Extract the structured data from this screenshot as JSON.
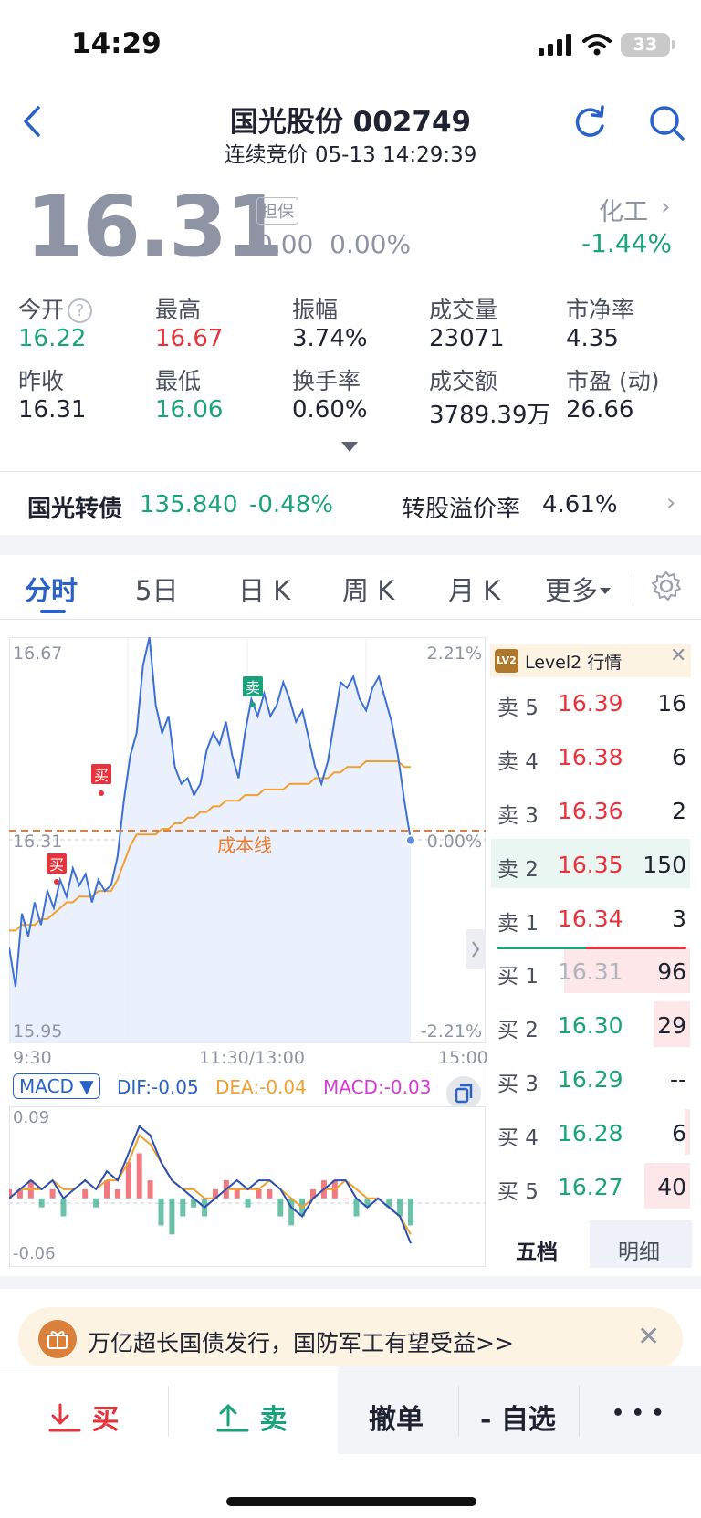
{
  "status_bar": {
    "time": "14:29",
    "battery": "33"
  },
  "header": {
    "title": "国光股份 002749",
    "subtitle": "连续竞价 05-13 14:29:39"
  },
  "quote": {
    "price": "16.31",
    "guarantee_tag": "担保",
    "change": "0.00",
    "change_pct": "0.00%",
    "sector_name": "化工",
    "sector_change": "-1.44%"
  },
  "stats": [
    {
      "label": "今开",
      "value": "16.22",
      "color": "green"
    },
    {
      "label": "最高",
      "value": "16.67",
      "color": "red"
    },
    {
      "label": "振幅",
      "value": "3.74%",
      "color": "neutral"
    },
    {
      "label": "成交量",
      "value": "23071",
      "color": "neutral"
    },
    {
      "label": "市净率",
      "value": "4.35",
      "color": "neutral"
    },
    {
      "label": "昨收",
      "value": "16.31",
      "color": "neutral"
    },
    {
      "label": "最低",
      "value": "16.06",
      "color": "green"
    },
    {
      "label": "换手率",
      "value": "0.60%",
      "color": "neutral"
    },
    {
      "label": "成交额",
      "value": "3789.39万",
      "color": "neutral"
    },
    {
      "label": "市盈 (动)",
      "value": "26.66",
      "color": "neutral"
    }
  ],
  "bond": {
    "name": "国光转债",
    "price": "135.840",
    "change": "-0.48%",
    "premium_label": "转股溢价率",
    "premium_value": "4.61%"
  },
  "tabs": [
    "分时",
    "5日",
    "日 K",
    "周 K",
    "月 K",
    "更多"
  ],
  "active_tab": "分时",
  "chart": {
    "y_top": "16.67",
    "y_mid": "16.31",
    "y_bottom": "15.95",
    "pct_top": "2.21%",
    "pct_mid": "0.00%",
    "pct_bottom": "-2.21%",
    "x_labels": [
      "9:30",
      "11:30/13:00",
      "15:00"
    ],
    "cost_line_label": "成本线",
    "buy_marker": "买",
    "sell_marker": "卖"
  },
  "macd": {
    "selector": "MACD ▼",
    "dif": "DIF:-0.05",
    "dea": "DEA:-0.04",
    "macd": "MACD:-0.03",
    "y_top": "0.09",
    "y_bottom": "-0.06"
  },
  "chart_data": {
    "type": "line",
    "title": "",
    "x_labels": [
      "9:30",
      "11:30/13:00",
      "15:00"
    ],
    "ylim": [
      15.95,
      16.67
    ],
    "series": [
      {
        "name": "price",
        "values": [
          16.12,
          16.05,
          16.18,
          16.14,
          16.2,
          16.16,
          16.22,
          16.19,
          16.24,
          16.21,
          16.26,
          16.23,
          16.25,
          16.2,
          16.24,
          16.22,
          16.23,
          16.28,
          16.38,
          16.46,
          16.5,
          16.62,
          16.67,
          16.55,
          16.5,
          16.53,
          16.44,
          16.41,
          16.42,
          16.39,
          16.41,
          16.47,
          16.5,
          16.48,
          16.52,
          16.46,
          16.42,
          16.5,
          16.56,
          16.53,
          16.57,
          16.53,
          16.55,
          16.59,
          16.56,
          16.52,
          16.54,
          16.49,
          16.44,
          16.41,
          16.45,
          16.52,
          16.59,
          16.58,
          16.6,
          16.56,
          16.54,
          16.58,
          16.6,
          16.56,
          16.52,
          16.46,
          16.38,
          16.31
        ]
      },
      {
        "name": "avg",
        "values": [
          16.15,
          16.15,
          16.16,
          16.16,
          16.16,
          16.17,
          16.17,
          16.18,
          16.19,
          16.2,
          16.2,
          16.21,
          16.21,
          16.21,
          16.22,
          16.22,
          16.22,
          16.24,
          16.27,
          16.3,
          16.32,
          16.32,
          16.32,
          16.32,
          16.33,
          16.33,
          16.34,
          16.34,
          16.35,
          16.35,
          16.36,
          16.36,
          16.37,
          16.37,
          16.38,
          16.38,
          16.38,
          16.39,
          16.39,
          16.39,
          16.4,
          16.4,
          16.4,
          16.4,
          16.41,
          16.41,
          16.41,
          16.41,
          16.42,
          16.42,
          16.42,
          16.43,
          16.43,
          16.44,
          16.44,
          16.44,
          16.45,
          16.45,
          16.45,
          16.45,
          16.45,
          16.45,
          16.44,
          16.44
        ]
      }
    ]
  },
  "macd_data": {
    "dif": [
      0.0,
      0.01,
      0.02,
      0.01,
      0.02,
      0.0,
      0.01,
      0.02,
      0.01,
      0.03,
      0.02,
      0.05,
      0.08,
      0.07,
      0.04,
      0.02,
      0.01,
      0.0,
      -0.01,
      0.0,
      0.01,
      0.02,
      0.01,
      0.02,
      0.02,
      0.01,
      -0.01,
      -0.02,
      0.0,
      0.01,
      0.02,
      0.02,
      0.0,
      -0.01,
      0.0,
      -0.01,
      -0.02,
      -0.05
    ],
    "dea": [
      0.0,
      0.01,
      0.01,
      0.01,
      0.02,
      0.01,
      0.01,
      0.02,
      0.01,
      0.02,
      0.02,
      0.04,
      0.07,
      0.06,
      0.04,
      0.02,
      0.01,
      0.01,
      0.0,
      0.0,
      0.01,
      0.01,
      0.01,
      0.01,
      0.02,
      0.01,
      0.0,
      -0.01,
      0.0,
      0.01,
      0.01,
      0.02,
      0.01,
      0.0,
      0.0,
      -0.01,
      -0.02,
      -0.04
    ],
    "hist": [
      0.01,
      0.01,
      0.02,
      -0.01,
      0.01,
      -0.02,
      0.0,
      0.01,
      -0.01,
      0.02,
      0.01,
      0.04,
      0.05,
      0.02,
      -0.03,
      -0.04,
      -0.02,
      -0.01,
      -0.02,
      0.01,
      0.02,
      0.01,
      -0.01,
      0.01,
      0.01,
      -0.02,
      -0.03,
      -0.02,
      0.01,
      0.02,
      0.02,
      0.0,
      -0.02,
      -0.01,
      0.0,
      -0.01,
      -0.02,
      -0.03
    ]
  },
  "order_book": {
    "header": "Level2 行情",
    "asks": [
      {
        "label": "卖 5",
        "price": "16.39",
        "qty": "16"
      },
      {
        "label": "卖 4",
        "price": "16.38",
        "qty": "6"
      },
      {
        "label": "卖 3",
        "price": "16.36",
        "qty": "2"
      },
      {
        "label": "卖 2",
        "price": "16.35",
        "qty": "150"
      },
      {
        "label": "卖 1",
        "price": "16.34",
        "qty": "3"
      }
    ],
    "bids": [
      {
        "label": "买 1",
        "price": "16.31",
        "qty": "96"
      },
      {
        "label": "买 2",
        "price": "16.30",
        "qty": "29"
      },
      {
        "label": "买 3",
        "price": "16.29",
        "qty": "--"
      },
      {
        "label": "买 4",
        "price": "16.28",
        "qty": "6"
      },
      {
        "label": "买 5",
        "price": "16.27",
        "qty": "40"
      }
    ],
    "tabs": [
      "五档",
      "明细"
    ]
  },
  "banner": {
    "text": "万亿超长国债发行，国防军工有望受益>>"
  },
  "bottom_bar": {
    "buy": "买",
    "sell": "卖",
    "cancel": "撤单",
    "watchlist": "- 自选",
    "more": "• • •"
  },
  "colors": {
    "up": "#e8323c",
    "down": "#1aa37a",
    "accent": "#2a62c9",
    "price_line": "#3d6fd6",
    "avg_line": "#f0a030",
    "cost_line": "#f07a2a"
  }
}
